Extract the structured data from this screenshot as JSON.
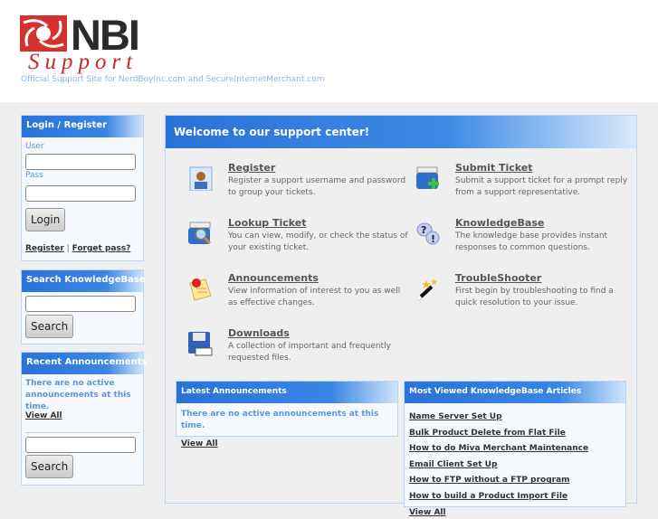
{
  "header": {
    "logo_text": "NBI",
    "logo_sub": "Support",
    "tagline": "Official Support Site for NerdBoyInc.com and SecureInternetMerchant.com"
  },
  "login": {
    "title": "Login / Register",
    "user_label": "User",
    "pass_label": "Pass",
    "login_button": "Login",
    "register_link": "Register",
    "separator": "|",
    "forgot_link": "Forget pass?"
  },
  "search_kb": {
    "title": "Search KnowledgeBase",
    "button": "Search"
  },
  "recent": {
    "title": "Recent Announcements",
    "message": "There are no active announcements at this time.",
    "view_all": "View All",
    "button": "Search"
  },
  "main": {
    "title": "Welcome to our support center!",
    "items": [
      {
        "title": "Register",
        "desc": "Register a support username and password to group your tickets.",
        "icon": "user-card-icon"
      },
      {
        "title": "Submit Ticket",
        "desc": "Submit a support ticket for a prompt reply from a support representative.",
        "icon": "submit-ticket-icon"
      },
      {
        "title": "Lookup Ticket",
        "desc": "You can view, modify, or check the status of your existing ticket.",
        "icon": "magnifier-icon"
      },
      {
        "title": "KnowledgeBase",
        "desc": "The knowledge base provides instant responses to common questions.",
        "icon": "question-bubble-icon"
      },
      {
        "title": "Announcements",
        "desc": "View information of interest to you as well as effective changes.",
        "icon": "note-pin-icon"
      },
      {
        "title": "TroubleShooter",
        "desc": "First begin by troubleshooting to find a quick resolution to your issue.",
        "icon": "magic-wand-icon"
      },
      {
        "title": "Downloads",
        "desc": "A collection of important and frequently requested files.",
        "icon": "floppy-disk-icon"
      }
    ]
  },
  "latest": {
    "title": "Latest Announcements",
    "message": "There are no active announcements at this time.",
    "view_all": "View All"
  },
  "most_viewed": {
    "title": "Most Viewed KnowledgeBase Articles",
    "articles": [
      "Name Server Set Up",
      "Bulk Product Delete from Flat File",
      "How to do Miva Merchant Maintenance",
      "Email Client Set Up",
      "How to FTP without a FTP program",
      "How to build a Product Import File"
    ],
    "view_all": "View All"
  }
}
